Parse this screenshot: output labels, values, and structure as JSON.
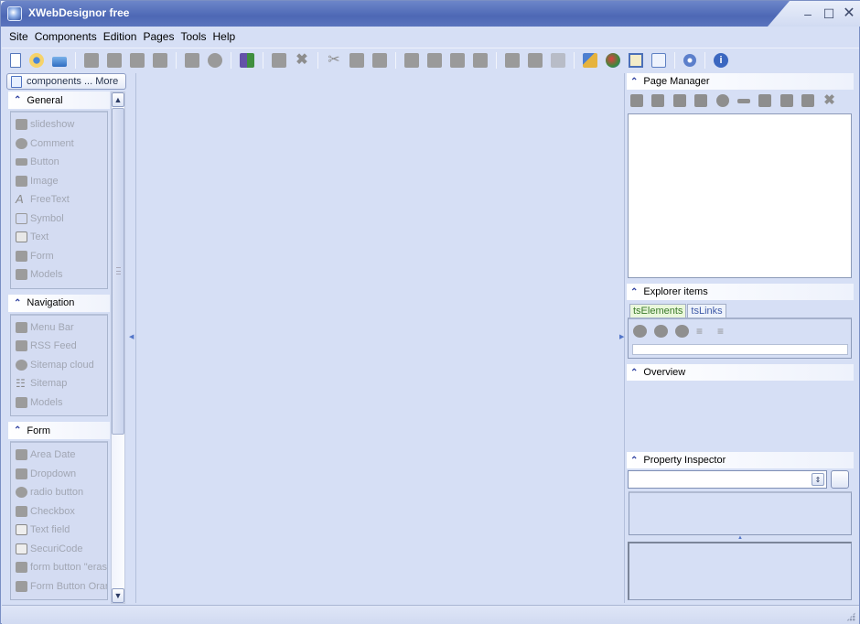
{
  "window": {
    "title": "XWebDesignor free"
  },
  "menu": [
    "Site",
    "Components",
    "Edition",
    "Pages",
    "Tools",
    "Help"
  ],
  "toolbar": {
    "groups": [
      [
        "new-page-icon",
        "open-icon",
        "open-folder-icon"
      ],
      [
        "widget-icon",
        "widget2-icon",
        "cart-icon",
        "frame-icon"
      ],
      [
        "layer-icon",
        "circle-icon"
      ],
      [
        "module-icon"
      ],
      [
        "square-icon",
        "delete-icon"
      ],
      [
        "cut-icon",
        "copy-icon",
        "paste-icon"
      ],
      [
        "bring-front-icon",
        "send-back-icon",
        "forward-icon",
        "backward-icon"
      ],
      [
        "edit-icon",
        "lock-icon",
        "paint-icon"
      ],
      [
        "tools-icon",
        "colors-icon",
        "image-icon",
        "document-icon"
      ],
      [
        "help-icon"
      ],
      [
        "info-icon"
      ]
    ]
  },
  "left_panel": {
    "more_button": "components ... More",
    "groups": [
      {
        "title": "General",
        "items": [
          "slideshow",
          "Comment",
          "Button",
          "Image",
          "FreeText",
          "Symbol",
          "Text",
          "Form",
          "Models"
        ]
      },
      {
        "title": "Navigation",
        "items": [
          "Menu Bar",
          "RSS Feed",
          "Sitemap cloud",
          "Sitemap",
          "Models"
        ]
      },
      {
        "title": "Form",
        "items": [
          "Area Date",
          "Dropdown",
          "radio button",
          "Checkbox",
          "Text field",
          "SecuriCode",
          "form button \"erase",
          "Form Button Orang"
        ]
      }
    ]
  },
  "right_panel": {
    "page_manager": {
      "title": "Page Manager"
    },
    "explorer": {
      "title": "Explorer items",
      "tabs": [
        "tsElements",
        "tsLinks"
      ],
      "active_tab": "tsElements",
      "search_value": ""
    },
    "overview": {
      "title": "Overview"
    },
    "property_inspector": {
      "title": "Property Inspector",
      "selected": ""
    }
  },
  "colors": {
    "titlebar": "#4d68b5",
    "background": "#d6dff5",
    "accent": "#2c3e9f"
  }
}
